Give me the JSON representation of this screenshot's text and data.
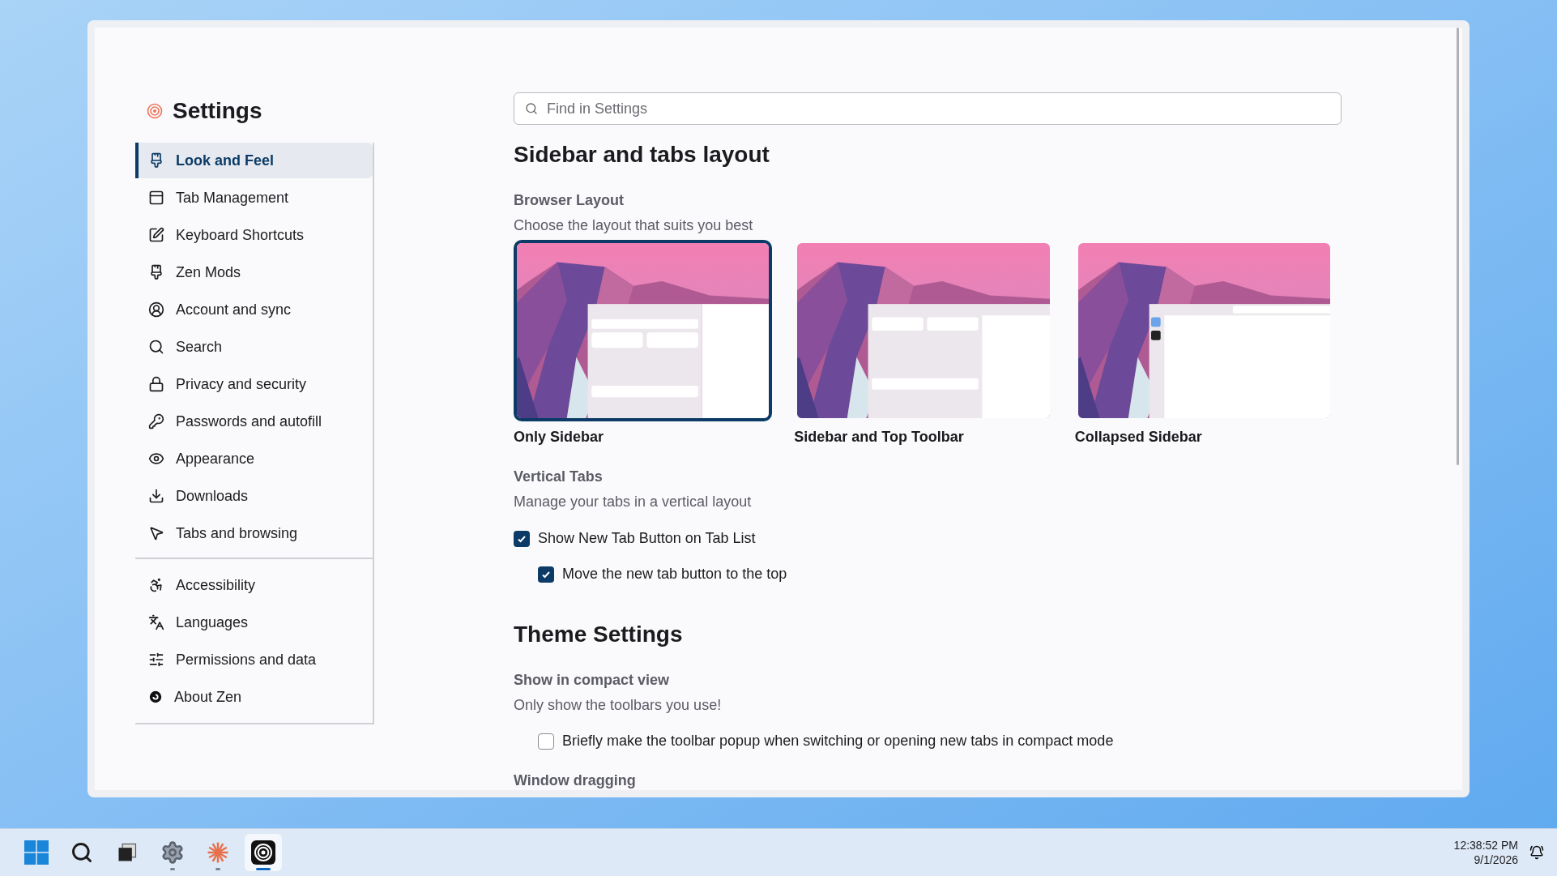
{
  "window": {
    "title": "Settings"
  },
  "search": {
    "placeholder": "Find in Settings"
  },
  "sidebar": {
    "groups": [
      {
        "items": [
          {
            "label": "Look and Feel",
            "selected": true
          },
          {
            "label": "Tab Management",
            "selected": false
          },
          {
            "label": "Keyboard Shortcuts",
            "selected": false
          },
          {
            "label": "Zen Mods",
            "selected": false
          },
          {
            "label": "Account and sync",
            "selected": false
          },
          {
            "label": "Search",
            "selected": false
          },
          {
            "label": "Privacy and security",
            "selected": false
          },
          {
            "label": "Passwords and autofill",
            "selected": false
          },
          {
            "label": "Appearance",
            "selected": false
          },
          {
            "label": "Downloads",
            "selected": false
          },
          {
            "label": "Tabs and browsing",
            "selected": false
          }
        ]
      },
      {
        "items": [
          {
            "label": "Accessibility",
            "selected": false
          },
          {
            "label": "Languages",
            "selected": false
          },
          {
            "label": "Permissions and data",
            "selected": false
          },
          {
            "label": "About Zen",
            "selected": false
          }
        ]
      }
    ]
  },
  "sections": [
    {
      "title": "Sidebar and tabs layout",
      "settings": [
        {
          "kind": "layouts",
          "label": "Browser Layout",
          "description": "Choose the layout that suits you best",
          "options": [
            {
              "label": "Only Sidebar",
              "kind": "sidebar",
              "selected": true
            },
            {
              "label": "Sidebar and Top Toolbar",
              "kind": "toolbar",
              "selected": false
            },
            {
              "label": "Collapsed Sidebar",
              "kind": "collapsed",
              "selected": false
            }
          ]
        },
        {
          "kind": "checkboxes",
          "label": "Vertical Tabs",
          "description": "Manage your tabs in a vertical layout",
          "checkboxes": [
            {
              "label": "Show New Tab Button on Tab List",
              "checked": true,
              "indented": false
            },
            {
              "label": "Move the new tab button to the top",
              "checked": true,
              "indented": true
            }
          ]
        }
      ]
    },
    {
      "title": "Theme Settings",
      "settings": [
        {
          "kind": "checkboxes",
          "label": "Show in compact view",
          "description": "Only show the toolbars you use!",
          "checkboxes": [
            {
              "label": "Briefly make the toolbar popup when switching or opening new tabs in compact mode",
              "checked": false,
              "indented": true
            }
          ]
        },
        {
          "kind": "heading",
          "label": "Window dragging"
        }
      ]
    }
  ],
  "taskbar": {
    "apps": [
      {
        "selected": false,
        "running": false
      },
      {
        "selected": false,
        "running": false
      },
      {
        "selected": false,
        "running": false
      },
      {
        "selected": false,
        "running": true
      },
      {
        "selected": false,
        "running": true
      },
      {
        "selected": true,
        "running": true
      }
    ],
    "clock": {
      "time": "12:38:52 PM",
      "date": "9/1/2026"
    }
  }
}
